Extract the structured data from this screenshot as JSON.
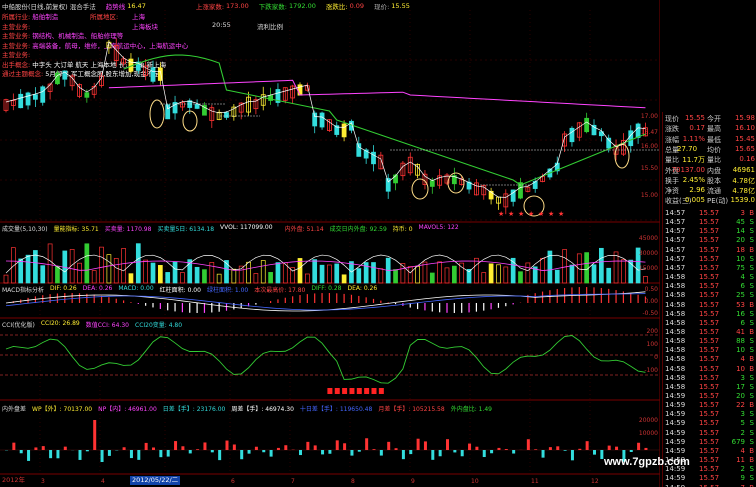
{
  "colors": {
    "bg": "#000000",
    "up": "#ff3333",
    "down": "#33dddd",
    "yellow": "#ffee33",
    "white": "#ffffff",
    "magenta": "#ff44ff",
    "green": "#33cc33",
    "blue": "#4466ff",
    "grid": "#550000",
    "axis": "#cc3333"
  },
  "header": {
    "title_line": "中船股份(日线,前复权) 混合手法",
    "pe_label": "趋势线",
    "pe_value": "16.47",
    "up_label": "上涨家数:",
    "up_value": "173.00",
    "down_label": "下跌家数:",
    "down_value": "1792.00",
    "ratio_label": "涨跌比:",
    "ratio_value": "0.09",
    "price_label": "现价:",
    "price_value": "15.55"
  },
  "info_panel": {
    "rows": [
      {
        "label": "所属行业:",
        "value": "船舶制造",
        "extra1": "所属地区:",
        "extra1_value": "上海",
        "extra2": "",
        "extra2_value": "",
        "extra3": "",
        "extra3_value": ""
      },
      {
        "label": "主营业务:",
        "value": "",
        "extra1": "",
        "extra1_value": "上海板块",
        "extra2": "",
        "extra2_value": "20:55",
        "extra3": "",
        "extra3_value": "流利比例"
      },
      {
        "label": "主营业务:",
        "value": "钢结构、机械制造、船舶修理等",
        "extra1": "",
        "extra1_value": "",
        "extra2": "",
        "extra2_value": "",
        "extra3": "",
        "extra3_value": ""
      },
      {
        "label": "主营业务:",
        "value": "高端装备，航母，维修，上海航运中心，上海航运中心",
        "extra1": "",
        "extra1_value": "",
        "extra2": "",
        "extra2_value": "",
        "extra3": "",
        "extra3_value": ""
      },
      {
        "label": "主营业务:",
        "value": "",
        "extra1": "",
        "extra1_value": "",
        "extra2": "",
        "extra2_value": "",
        "extra3": "",
        "extra3_value": ""
      },
      {
        "label": "出手概念:",
        "value": "中字头 大订单 航天 上海本地 长江三角 新上海",
        "extra1": "",
        "extra1_value": "",
        "extra2": "",
        "extra2_value": "",
        "extra3": "",
        "extra3_value": ""
      },
      {
        "label": "通过主题概念:",
        "value": "5月解禁,军工概念股,股东增加,现金不足",
        "extra1": "",
        "extra1_value": "",
        "extra2": "",
        "extra2_value": "",
        "extra3": "",
        "extra3_value": ""
      }
    ]
  },
  "quote": {
    "rows": [
      {
        "l1": "现价",
        "v1": "15.55",
        "l2": "今开",
        "v2": "15.98"
      },
      {
        "l1": "涨跌",
        "v1": "0.17",
        "l2": "最高",
        "v2": "16.10"
      },
      {
        "l1": "涨幅",
        "v1": "1.11%",
        "l2": "最低",
        "v2": "15.45"
      },
      {
        "l1": "总量",
        "v1": "",
        "l2": "均价",
        "v2": "15.65"
      },
      {
        "l1": "量比",
        "v1": "11.7万",
        "l2": "量比",
        "v2": "0.16"
      },
      {
        "l1": "外盘",
        "v1": "70137.00",
        "l2": "内盘",
        "v2": "46961"
      },
      {
        "l1": "换手",
        "v1": "2.45%",
        "l2": "股本",
        "v2": "4.78亿"
      },
      {
        "l1": "净资",
        "v1": "2.96",
        "l2": "流通",
        "v2": "4.78亿"
      },
      {
        "l1": "收益(三)",
        "v1": "0.005",
        "l2": "PE(动)",
        "v2": "1539.0"
      }
    ],
    "extra_zoom": "27.70"
  },
  "ticks": [
    {
      "t": "14:57",
      "p": "15.57",
      "v": "3",
      "d": "B"
    },
    {
      "t": "14:57",
      "p": "15.57",
      "v": "45",
      "d": "S"
    },
    {
      "t": "14:57",
      "p": "15.57",
      "v": "14",
      "d": "S"
    },
    {
      "t": "14:57",
      "p": "15.57",
      "v": "20",
      "d": "S"
    },
    {
      "t": "14:57",
      "p": "15.57",
      "v": "18",
      "d": "B"
    },
    {
      "t": "14:57",
      "p": "15.57",
      "v": "10",
      "d": "S"
    },
    {
      "t": "14:57",
      "p": "15.57",
      "v": "75",
      "d": "S"
    },
    {
      "t": "14:58",
      "p": "15.57",
      "v": "4",
      "d": "S"
    },
    {
      "t": "14:58",
      "p": "15.57",
      "v": "6",
      "d": "S"
    },
    {
      "t": "14:58",
      "p": "15.57",
      "v": "25",
      "d": "S"
    },
    {
      "t": "14:58",
      "p": "15.57",
      "v": "53",
      "d": "B"
    },
    {
      "t": "14:58",
      "p": "15.57",
      "v": "16",
      "d": "S"
    },
    {
      "t": "14:58",
      "p": "15.57",
      "v": "6",
      "d": "S"
    },
    {
      "t": "14:58",
      "p": "15.57",
      "v": "41",
      "d": "B"
    },
    {
      "t": "14:58",
      "p": "15.57",
      "v": "88",
      "d": "S"
    },
    {
      "t": "14:58",
      "p": "15.57",
      "v": "10",
      "d": "S"
    },
    {
      "t": "14:58",
      "p": "15.57",
      "v": "4",
      "d": "B"
    },
    {
      "t": "14:58",
      "p": "15.57",
      "v": "10",
      "d": "B"
    },
    {
      "t": "14:58",
      "p": "15.57",
      "v": "3",
      "d": "S"
    },
    {
      "t": "14:58",
      "p": "15.57",
      "v": "17",
      "d": "S"
    },
    {
      "t": "14:59",
      "p": "15.57",
      "v": "20",
      "d": "S"
    },
    {
      "t": "14:59",
      "p": "15.57",
      "v": "22",
      "d": "B"
    },
    {
      "t": "14:59",
      "p": "15.57",
      "v": "3",
      "d": "S"
    },
    {
      "t": "14:59",
      "p": "15.57",
      "v": "5",
      "d": "S"
    },
    {
      "t": "14:59",
      "p": "15.57",
      "v": "2",
      "d": "S"
    },
    {
      "t": "14:59",
      "p": "15.57",
      "v": "679",
      "d": "S"
    },
    {
      "t": "14:59",
      "p": "15.57",
      "v": "4",
      "d": "B"
    },
    {
      "t": "14:59",
      "p": "15.57",
      "v": "11",
      "d": "B"
    },
    {
      "t": "14:59",
      "p": "15.57",
      "v": "2",
      "d": "S"
    },
    {
      "t": "14:59",
      "p": "15.57",
      "v": "9",
      "d": "S"
    },
    {
      "t": "14:59",
      "p": "15.57",
      "v": "7",
      "d": "B"
    }
  ],
  "price_axis": [
    "17.00",
    "16.47",
    "16.00",
    "15.50",
    "15.00"
  ],
  "indicators": {
    "vol": {
      "label": "成交量(5,10,30)",
      "l1": "量能指标",
      "v1": "35.71",
      "l2": "买卖量",
      "v2": "1170.98",
      "l3": "买卖量5日",
      "v3": "6134.18",
      "l4": "VVOL",
      "v4": "117099.00",
      "l5": "",
      "v5": "",
      "l6": "内外盘",
      "v6": "51.14",
      "l7": "成交日内外盘",
      "v7": "92.59",
      "l8": "持币",
      "v8": "0",
      "l9": "MAVOL5",
      "v9": "122",
      "ticks": [
        "45000",
        "30000",
        "15000"
      ]
    },
    "macd": {
      "label": "MACD指标分析",
      "l1": "DIF",
      "v1": "0.26",
      "l2": "DEA",
      "v2": "0.26",
      "l3": "MACD",
      "v3": "0.00",
      "l4": "红柱面积",
      "v4": "0.00",
      "l5": "绿柱面积",
      "v5": "1.00",
      "l6": "本次最高价",
      "v6": "17.80",
      "l7": "DIFF",
      "v7": "0.28",
      "l8": "DEA",
      "v8": "0.26",
      "ticks": [
        "0.50",
        "0.00",
        "-0.50"
      ]
    },
    "cci": {
      "label": "CCI(优化版)",
      "l1": "CCI20",
      "v1": "26.89",
      "l2": "数值CCI",
      "v2": "64.30",
      "l3": "CCI20变量",
      "v3": "4.80",
      "ticks": [
        "200",
        "100",
        "0",
        "-100"
      ]
    },
    "flow": {
      "label": "内外盘差",
      "l1": "WP【外】",
      "v1": "70137.00",
      "l2": "NP【内】",
      "v2": "46961.00",
      "l3": "日差【手】",
      "v3": "23176.00",
      "l4": "周差【手】",
      "v4": "46974.30",
      "l5": "十日差【手】",
      "v5": "119650.48",
      "l6": "月差【手】",
      "v6": "105215.58",
      "l7": "外内盘比",
      "v7": "1.49",
      "ticks": [
        "20000",
        "10000"
      ]
    }
  },
  "xaxis": {
    "year": "2012年",
    "date_cursor": "2012/05/22/二",
    "months": [
      "3",
      "4",
      "5",
      "6",
      "7",
      "8",
      "9",
      "10",
      "11",
      "12"
    ]
  },
  "watermark": "www.7gpzb.com"
}
